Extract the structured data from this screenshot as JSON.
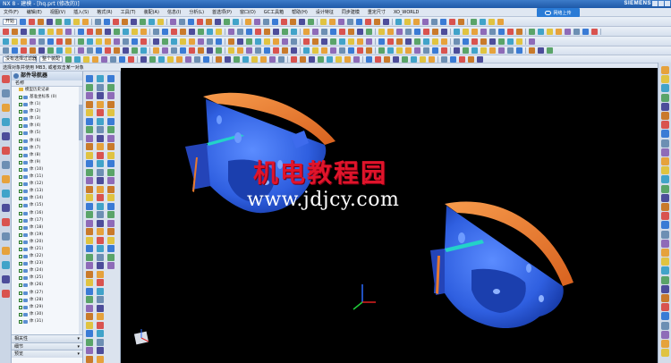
{
  "window": {
    "title": "NX 8 - 建模 - [hq.prt (修改的)]",
    "brand": "SIEMENS"
  },
  "menu": {
    "items": [
      "开始",
      "文件(F)",
      "编辑(E)",
      "视图(V)",
      "插入(S)",
      "格式(R)",
      "工具(T)",
      "装配(A)",
      "信息(I)",
      "分析(L)",
      "首选项(P)",
      "窗口(O)",
      "GC工具箱",
      "帮助(H)"
    ],
    "right_items": [
      "设计特征",
      "同步建模",
      "重定尺寸",
      "XO_WORLD"
    ],
    "internet_button": "网络上传"
  },
  "toolbar": {
    "filter_label": "没有选择过滤器",
    "scope_label": "整个装配",
    "selection_prompt": "选择对象并使用 MB3, 或者双击某一对象"
  },
  "navigator": {
    "title": "部件导航器",
    "column_name": "名称",
    "root_label": "模型历史记录",
    "first_item": "基准坐标系 (0)",
    "items": [
      "体 (1)",
      "体 (2)",
      "体 (3)",
      "体 (4)",
      "体 (5)",
      "体 (6)",
      "体 (7)",
      "体 (8)",
      "体 (9)",
      "体 (10)",
      "体 (11)",
      "体 (12)",
      "体 (13)",
      "体 (14)",
      "体 (15)",
      "体 (16)",
      "体 (17)",
      "体 (18)",
      "体 (19)",
      "体 (20)",
      "体 (21)",
      "体 (22)",
      "体 (23)",
      "体 (24)",
      "体 (25)",
      "体 (26)",
      "体 (27)",
      "体 (28)",
      "体 (29)",
      "体 (30)",
      "体 (31)"
    ],
    "panels": [
      "相关性",
      "细节",
      "预览"
    ]
  },
  "watermark": {
    "chinese": "机电教程园",
    "url": "www.jdjcy.com"
  },
  "colors": {
    "background": "#000000",
    "part_blue": "#2f5fe0",
    "surface_orange": "#e87a2e",
    "watermark_red": "#e0142b",
    "ui_panel": "#dbe3ee"
  }
}
